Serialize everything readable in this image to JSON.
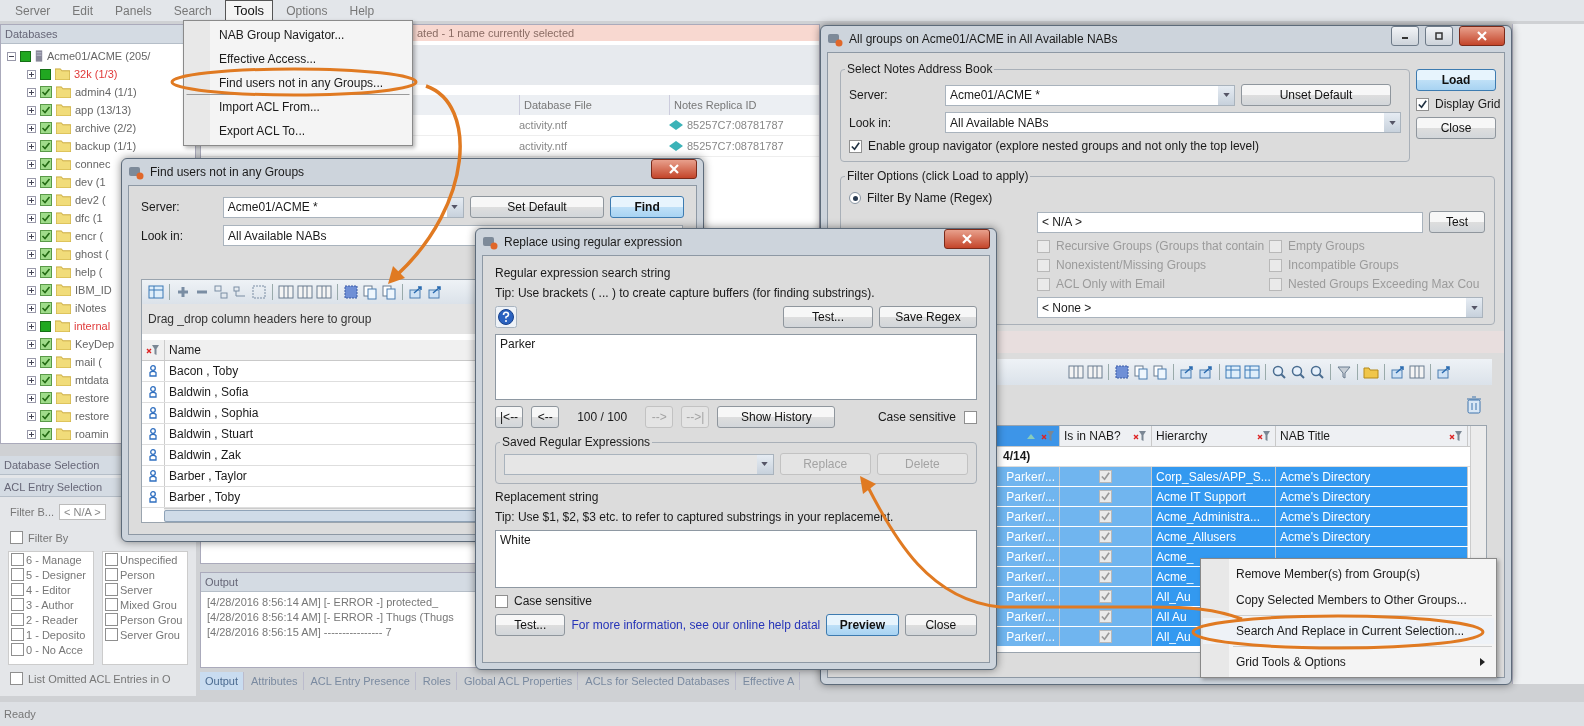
{
  "menu_bar": [
    {
      "label": "Server",
      "selected": false
    },
    {
      "label": "Edit",
      "selected": false
    },
    {
      "label": "Panels",
      "selected": false
    },
    {
      "label": "Search",
      "selected": false
    },
    {
      "label": "Tools",
      "selected": true
    },
    {
      "label": "Options",
      "selected": false
    },
    {
      "label": "Help",
      "selected": false
    }
  ],
  "tools_menu": [
    {
      "label": "NAB Group Navigator...",
      "highlighted": false
    },
    {
      "label": "Effective Access...",
      "highlighted": false
    },
    {
      "label": "Find users not in any Groups...",
      "highlighted": true
    },
    {
      "label": "Import ACL From...",
      "highlighted": false
    },
    {
      "label": "Export ACL To...",
      "highlighted": false
    }
  ],
  "databases_panel": {
    "title": "Databases",
    "tree": [
      {
        "label": "Acme01/ACME (205/",
        "expanded": true,
        "children": [
          {
            "label": "32k (1/3)",
            "kind": "error",
            "expanded": false
          },
          {
            "label": "admin4 (1/1)",
            "kind": "ok",
            "expanded": false
          },
          {
            "label": "app (13/13)",
            "kind": "ok",
            "expanded": false
          },
          {
            "label": "archive (2/2)",
            "kind": "ok",
            "expanded": false
          },
          {
            "label": "backup (1/1)",
            "kind": "ok",
            "expanded": false
          },
          {
            "label": "connec",
            "kind": "ok",
            "expanded": false
          },
          {
            "label": "dev (1",
            "kind": "ok",
            "expanded": false
          },
          {
            "label": "dev2 (",
            "kind": "ok",
            "expanded": false
          },
          {
            "label": "dfc (1",
            "kind": "ok",
            "expanded": false
          },
          {
            "label": "encr (",
            "kind": "ok",
            "expanded": false
          },
          {
            "label": "ghost (",
            "kind": "ok",
            "expanded": false
          },
          {
            "label": "help (",
            "kind": "ok",
            "expanded": false
          },
          {
            "label": "IBM_ID",
            "kind": "ok",
            "expanded": false
          },
          {
            "label": "iNotes",
            "kind": "ok",
            "expanded": false
          },
          {
            "label": "internal",
            "kind": "error",
            "expanded": false
          },
          {
            "label": "KeyDep",
            "kind": "ok",
            "expanded": false
          },
          {
            "label": "mail (",
            "kind": "ok",
            "expanded": false
          },
          {
            "label": "mtdata",
            "kind": "ok",
            "expanded": false
          },
          {
            "label": "restore",
            "kind": "ok",
            "expanded": false
          },
          {
            "label": "restore",
            "kind": "ok",
            "expanded": false
          },
          {
            "label": "roamin",
            "kind": "ok",
            "expanded": false
          }
        ]
      }
    ]
  },
  "info_strip": "ated - 1 name currently selected",
  "db_grid": {
    "columns": [
      "Database File",
      "Notes Replica ID"
    ],
    "rows": [
      {
        "file": "activity.ntf",
        "replica_id": "85257C7:08781787"
      },
      {
        "file": "activity.ntf",
        "replica_id": "85257C7:08781787"
      }
    ]
  },
  "selection_panel": {
    "database_selection": "Database Selection",
    "acl_entry_selection": "ACL Entry Selection",
    "filter_label": "Filter B...",
    "filter_value": "< N/A >",
    "filter_by": {
      "label": "Filter By",
      "checked": false
    },
    "levels": [
      {
        "label": "6 - Manage",
        "checked": false
      },
      {
        "label": "5 - Designer",
        "checked": false
      },
      {
        "label": "4 - Editor",
        "checked": false
      },
      {
        "label": "3 - Author",
        "checked": false
      },
      {
        "label": "2 - Reader",
        "checked": false
      },
      {
        "label": "1 - Deposito",
        "checked": false
      },
      {
        "label": "0 - No Acce",
        "checked": false
      }
    ],
    "types": [
      {
        "label": "Unspecified",
        "checked": false
      },
      {
        "label": "Person",
        "checked": false
      },
      {
        "label": "Server",
        "checked": false
      },
      {
        "label": "Mixed Grou",
        "checked": false
      },
      {
        "label": "Person Grou",
        "checked": false
      },
      {
        "label": "Server Grou",
        "checked": false
      }
    ],
    "list_omitted": {
      "label": "List Omitted ACL Entries in O",
      "checked": false
    }
  },
  "output_panel": {
    "title": "Output",
    "lines": [
      "[4/28/2016 8:56:14 AM] [- ERROR -] protected_",
      "[4/28/2016 8:56:14 AM] [- ERROR -] Thugs (Thugs",
      "[4/28/2016 8:56:15 AM] ---------------- 7"
    ]
  },
  "bottom_tabs": [
    {
      "label": "Output",
      "selected": true
    },
    {
      "label": "Attributes",
      "selected": false
    },
    {
      "label": "ACL Entry Presence",
      "selected": false
    },
    {
      "label": "Roles",
      "selected": false
    },
    {
      "label": "Global ACL Properties",
      "selected": false
    },
    {
      "label": "ACLs for Selected Databases",
      "selected": false
    },
    {
      "label": "Effective A",
      "selected": false
    }
  ],
  "status_bar": "Ready",
  "find_users_dialog": {
    "title": "Find users not in any Groups",
    "server_label": "Server:",
    "server": "Acme01/ACME *",
    "look_in_label": "Look in:",
    "look_in": "All Available NABs",
    "buttons": [
      {
        "label": "Set Default",
        "default": false
      },
      {
        "label": "Find",
        "default": true
      }
    ],
    "group_hint": "Drag _drop column headers here to group",
    "column": "Name",
    "rows": [
      "Bacon , Toby",
      "Baldwin , Sofia",
      "Baldwin , Sophia",
      "Baldwin , Stuart",
      "Baldwin , Zak",
      "Barber , Taylor",
      "Barber , Toby"
    ]
  },
  "replace_dialog": {
    "title": "Replace using regular expression",
    "search_heading": "Regular expression search string",
    "search_tip": "Tip: Use brackets ( ... ) to create capture buffers (for finding substrings).",
    "top_buttons": [
      {
        "label": "Test...",
        "disabled": false
      },
      {
        "label": "Save Regex",
        "disabled": false
      }
    ],
    "search_value": "Parker",
    "nav_buttons": [
      {
        "label": "|<--",
        "disabled": false
      },
      {
        "label": "<--",
        "disabled": false
      }
    ],
    "position": "100 / 100",
    "nav_buttons_next": [
      {
        "label": "-->",
        "disabled": true
      },
      {
        "label": "-->|",
        "disabled": true
      }
    ],
    "history_button": "Show History",
    "case_sensitive_top": {
      "label": "Case sensitive",
      "checked": false
    },
    "saved_legend": "Saved Regular Expressions",
    "saved_buttons": [
      {
        "label": "Replace",
        "disabled": true
      },
      {
        "label": "Delete",
        "disabled": true
      }
    ],
    "replacement_heading": "Replacement string",
    "replacement_tip": "Tip: Use $1, $2, $3 etc. to refer to captured substrings in your replacement.",
    "replacement_value": "White",
    "case_sensitive_bottom": {
      "label": "Case sensitive",
      "checked": false
    },
    "test_button": "Test...",
    "help_link": "For more information, see our online help datal",
    "bottom_buttons": [
      {
        "label": "Preview",
        "default": true
      },
      {
        "label": "Close",
        "default": false
      }
    ]
  },
  "all_groups_window": {
    "title": "All groups on Acme01/ACME in All Available NABs",
    "address_book": {
      "legend": "Select Notes Address Book",
      "server_label": "Server:",
      "server": "Acme01/ACME *",
      "unset_button": "Unset Default",
      "look_in_label": "Look in:",
      "look_in": "All Available NABs",
      "navigator": {
        "label": "Enable group navigator (explore nested groups and not only the top level)",
        "checked": true
      }
    },
    "load_button": {
      "label": "Load",
      "default": true
    },
    "display_grid": {
      "label": "Display Grid",
      "checked": true
    },
    "close_button": {
      "label": "Close",
      "default": false
    },
    "filter": {
      "legend": "Filter Options (click Load to apply)",
      "radio": {
        "label": "Filter By Name (Regex)",
        "selected": true
      },
      "regex": "< N/A >",
      "test_button": "Test",
      "options": [
        {
          "label": "Recursive Groups (Groups that contain",
          "checked": false,
          "disabled": true
        },
        {
          "label": "Empty Groups",
          "checked": false,
          "disabled": true
        },
        {
          "label": "Nonexistent/Missing Groups",
          "checked": false,
          "disabled": true
        },
        {
          "label": "Incompatible Groups",
          "checked": false,
          "disabled": true
        },
        {
          "label": "ACL Only with Email",
          "checked": false,
          "disabled": true
        },
        {
          "label": "Nested Groups Exceeding Max Cou",
          "checked": false,
          "disabled": true
        }
      ],
      "dropdown": "< None >"
    },
    "grid": {
      "columns": [
        "Is in NAB?",
        "Hierarchy",
        "NAB Title"
      ],
      "group_row": "4/14)",
      "rows": [
        {
          "member": "Parker/...",
          "in_nab": true,
          "hierarchy": "Corp_Sales/APP_S...",
          "nab_title": "Acme's Directory",
          "selected": true
        },
        {
          "member": "Parker/...",
          "in_nab": true,
          "hierarchy": "Acme IT Support",
          "nab_title": "Acme's Directory",
          "selected": true
        },
        {
          "member": "Parker/...",
          "in_nab": true,
          "hierarchy": "Acme_Administra...",
          "nab_title": "Acme's Directory",
          "selected": true
        },
        {
          "member": "Parker/...",
          "in_nab": true,
          "hierarchy": "Acme_Allusers",
          "nab_title": "Acme's Directory",
          "selected": true
        },
        {
          "member": "Parker/...",
          "in_nab": true,
          "hierarchy": "Acme_",
          "selected": true
        },
        {
          "member": "Parker/...",
          "in_nab": true,
          "hierarchy": "Acme_",
          "selected": true
        },
        {
          "member": "Parker/...",
          "in_nab": true,
          "hierarchy": "All_Au",
          "selected": true
        },
        {
          "member": "Parker/...",
          "in_nab": true,
          "hierarchy": "All Au",
          "selected": true
        },
        {
          "member": "Parker/...",
          "in_nab": true,
          "hierarchy": "All_Au",
          "selected": true
        }
      ]
    }
  },
  "context_menu": [
    {
      "label": "Remove Member(s) from Group(s)",
      "highlighted": false,
      "submenu": false
    },
    {
      "label": "Copy Selected Members to Other Groups...",
      "highlighted": false,
      "submenu": false
    },
    {
      "label": "Search And Replace in Current Selection...",
      "highlighted": true,
      "submenu": false
    },
    {
      "label": "Grid Tools & Options",
      "highlighted": false,
      "submenu": true
    }
  ]
}
